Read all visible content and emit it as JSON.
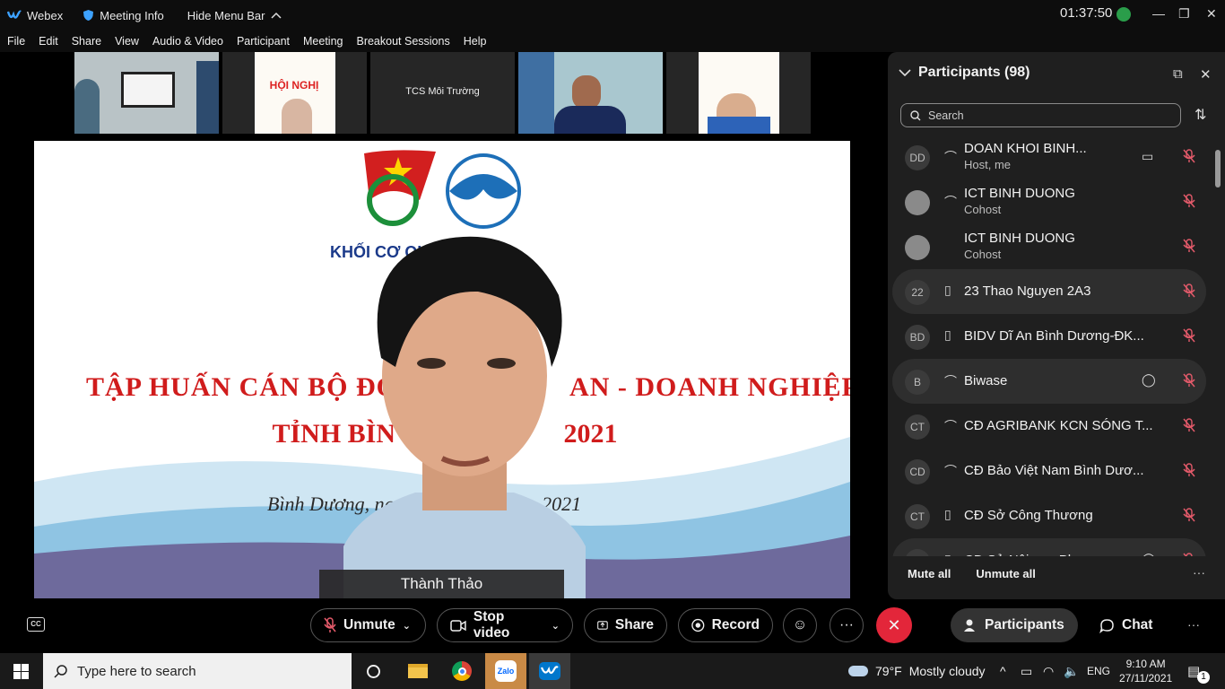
{
  "title_bar": {
    "app_name": "Webex",
    "meeting_info": "Meeting Info",
    "hide_menu": "Hide Menu Bar",
    "clock": "01:37:50"
  },
  "menu": [
    "File",
    "Edit",
    "Share",
    "View",
    "Audio & Video",
    "Participant",
    "Meeting",
    "Breakout Sessions",
    "Help"
  ],
  "thumbnails": [
    {
      "label": ""
    },
    {
      "label": ""
    },
    {
      "label": "TCS Môi Trường"
    },
    {
      "label": ""
    },
    {
      "label": ""
    }
  ],
  "stage": {
    "slide_org": "KHỐI CƠ QU",
    "slide_line1": "TẬP HUẤN CÁN BỘ ĐOÀ                    AN - DOANH NGHIỆP",
    "slide_line2": "TỈNH BÌN                         2021",
    "slide_line3": "Bình Dương, ng                        ăm 2021",
    "speaker_name": "Thành Thảo"
  },
  "panel": {
    "title": "Participants (98)",
    "search_placeholder": "Search",
    "participants": [
      {
        "initials": "DD",
        "name": "DOAN KHOI BINH...",
        "role": "Host, me",
        "device": "headset",
        "camera": true,
        "chat": false,
        "highlight": false,
        "photo": false
      },
      {
        "initials": "",
        "name": "ICT BINH DUONG",
        "role": "Cohost",
        "device": "headset",
        "camera": false,
        "chat": false,
        "highlight": false,
        "photo": true
      },
      {
        "initials": "",
        "name": "ICT BINH DUONG",
        "role": "Cohost",
        "device": "",
        "camera": false,
        "chat": false,
        "highlight": false,
        "photo": true
      },
      {
        "initials": "22",
        "name": "23 Thao Nguyen 2A3",
        "role": "",
        "device": "phone",
        "camera": false,
        "chat": false,
        "highlight": true,
        "photo": false
      },
      {
        "initials": "BD",
        "name": "BIDV Dĩ An Bình Dương-ĐK...",
        "role": "",
        "device": "phone",
        "camera": false,
        "chat": false,
        "highlight": false,
        "photo": false
      },
      {
        "initials": "B",
        "name": "Biwase",
        "role": "",
        "device": "headset",
        "camera": false,
        "chat": true,
        "highlight": true,
        "photo": false
      },
      {
        "initials": "CT",
        "name": "CĐ AGRIBANK KCN SÓNG T...",
        "role": "",
        "device": "headset",
        "camera": false,
        "chat": false,
        "highlight": false,
        "photo": false
      },
      {
        "initials": "CD",
        "name": "CĐ Bảo Việt Nam Bình Dươ...",
        "role": "",
        "device": "headset",
        "camera": false,
        "chat": false,
        "highlight": false,
        "photo": false
      },
      {
        "initials": "CT",
        "name": "CĐ Sở Công Thương",
        "role": "",
        "device": "phone",
        "camera": false,
        "chat": false,
        "highlight": false,
        "photo": false
      },
      {
        "initials": "CD",
        "name": "CĐ Sở Nội vụ - Phương...",
        "role": "",
        "device": "phone",
        "camera": false,
        "chat": true,
        "highlight": true,
        "photo": false
      }
    ],
    "mute_all": "Mute all",
    "unmute_all": "Unmute all"
  },
  "controls": {
    "unmute": "Unmute",
    "stop_video": "Stop video",
    "share": "Share",
    "record": "Record",
    "participants": "Participants",
    "chat": "Chat"
  },
  "taskbar": {
    "search_placeholder": "Type here to search",
    "weather_temp": "79°F",
    "weather_text": "Mostly cloudy",
    "lang": "ENG",
    "time": "9:10 AM",
    "date": "27/11/2021",
    "notif_count": "1"
  },
  "colors": {
    "end_call": "#e3263a",
    "mute_red": "#e35a6a",
    "panel_bg": "#1f1f1f"
  }
}
